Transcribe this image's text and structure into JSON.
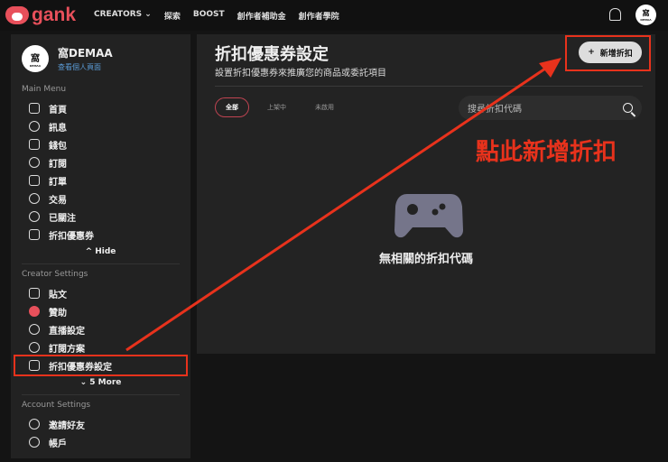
{
  "header": {
    "brand": "gank",
    "nav": [
      "CREATORS ⌄",
      "探索",
      "BOOST",
      "創作者補助金",
      "創作者學院"
    ],
    "avatar_text": "窩",
    "avatar_sub": "DEMAA"
  },
  "profile": {
    "name": "窩DEMAA",
    "link": "查看個人頁面"
  },
  "main_menu": {
    "title": "Main Menu",
    "items": [
      "首頁",
      "訊息",
      "錢包",
      "訂閱",
      "訂單",
      "交易",
      "已關注",
      "折扣優惠券"
    ],
    "toggle": "^ Hide"
  },
  "creator_settings": {
    "title": "Creator Settings",
    "items": [
      "貼文",
      "贊助",
      "直播設定",
      "訂閱方案",
      "折扣優惠券設定"
    ],
    "toggle": "⌄ 5 More"
  },
  "account_settings": {
    "title": "Account Settings",
    "items": [
      "邀請好友",
      "帳戶"
    ]
  },
  "page": {
    "title": "折扣優惠券設定",
    "subtitle": "設置折扣優惠券來推廣您的商品或委託項目",
    "add_button": "新增折扣",
    "tabs": [
      "全部",
      "上架中",
      "未啟用"
    ],
    "search_placeholder": "搜尋折扣代碼",
    "empty": "無相關的折扣代碼"
  },
  "annotation": {
    "text": "點此新增折扣",
    "color": "#e8321c"
  }
}
